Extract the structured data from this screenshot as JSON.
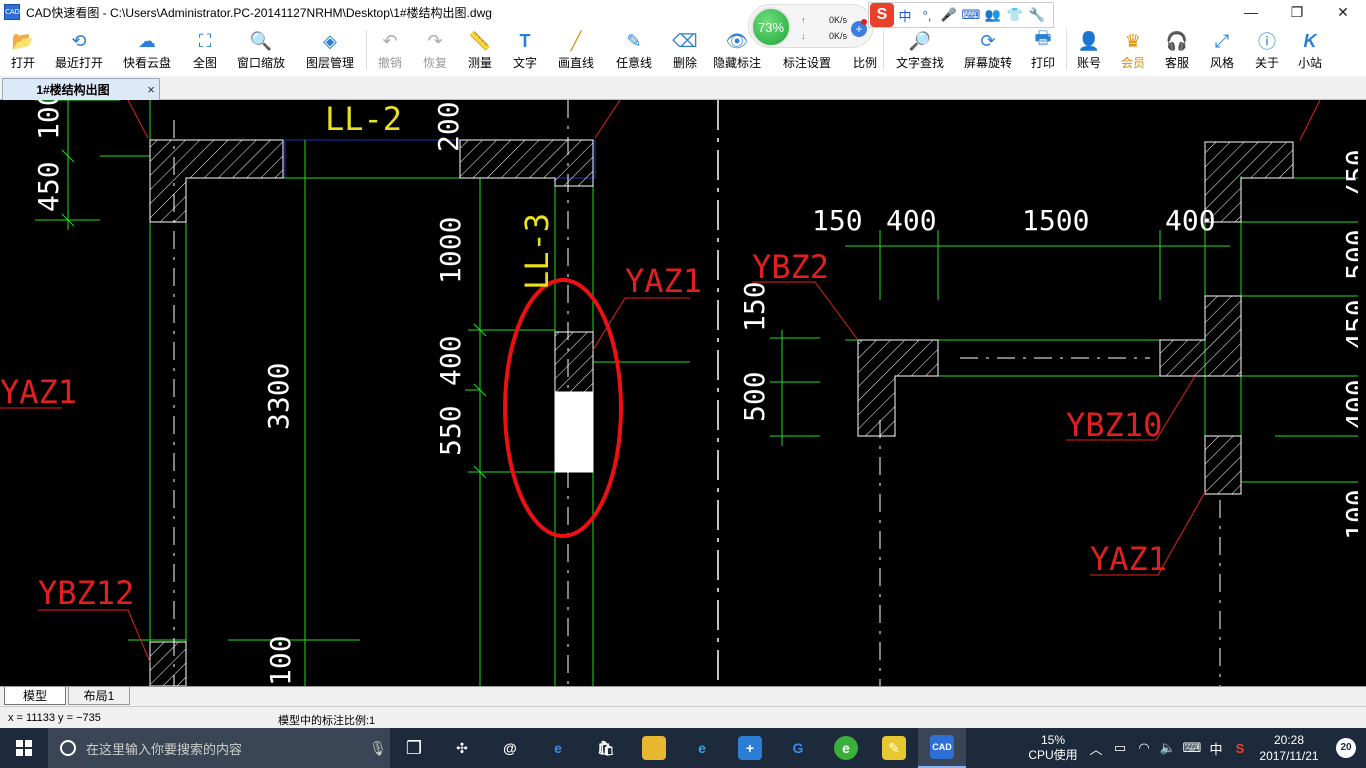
{
  "window": {
    "app_icon_text": "CAD",
    "title": "CAD快速看图 - C:\\Users\\Administrator.PC-20141127NRHM\\Desktop\\1#楼结构出图.dwg",
    "minimize": "—",
    "maximize": "❐",
    "close": "✕"
  },
  "net_widget": {
    "percent": "73%",
    "upload": "0K/s",
    "download": "0K/s",
    "up_arrow": "↑",
    "down_arrow": "↓",
    "plus": "+"
  },
  "ime": {
    "logo": "S",
    "items": [
      "中",
      "°,",
      "🎤",
      "⌨",
      "👥",
      "👕",
      "🔧"
    ]
  },
  "toolbar": {
    "open": "打开",
    "recent": "最近打开",
    "cloud": "快看云盘",
    "fit": "全图",
    "window_zoom": "窗口缩放",
    "layers": "图层管理",
    "undo": "撤销",
    "redo": "恢复",
    "measure": "测量",
    "text": "文字",
    "line": "画直线",
    "freeline": "任意线",
    "delete": "删除",
    "hide_annot": "隐藏标注",
    "annot_settings": "标注设置",
    "scale": "比例",
    "text_search": "文字查找",
    "rotate": "屏幕旋转",
    "print": "打印",
    "account": "账号",
    "vip": "会员",
    "service": "客服",
    "style": "风格",
    "about": "关于",
    "site": "小站"
  },
  "doc_tab": {
    "label": "1#楼结构出图",
    "close": "×"
  },
  "layout_tabs": {
    "model": "模型",
    "layout1": "布局1"
  },
  "status": {
    "coords": "x = 11133  y = −735",
    "scale_text": "模型中的标注比例:1"
  },
  "taskbar": {
    "search_placeholder": "在这里输入你要搜索的内容",
    "cpu_percent": "15%",
    "cpu_label": "CPU使用",
    "ime_lang": "中",
    "time": "20:28",
    "date": "2017/11/21",
    "notifications": "20"
  },
  "drawing": {
    "labels": {
      "ll2": "LL-2",
      "ll3": "LL-3",
      "yaz1_a": "YAZ1",
      "yaz1_b": "YAZ1",
      "yaz1_c": "YAZ1",
      "ybz2": "YBZ2",
      "ybz10": "YBZ10",
      "ybz12": "YBZ12"
    },
    "dims": {
      "d100_top": "100",
      "d450": "450",
      "d200": "200",
      "d1000": "1000",
      "d3300": "3300",
      "d400_left": "400",
      "d550": "550",
      "d100_bottom": "100",
      "d150_top": "150",
      "d400_top1": "400",
      "d1500": "1500",
      "d400_top2": "400",
      "d150_left": "150",
      "d500": "500",
      "r500": "500",
      "r450": "450",
      "r400": "400",
      "r100": "100",
      "r50": "/50"
    }
  }
}
